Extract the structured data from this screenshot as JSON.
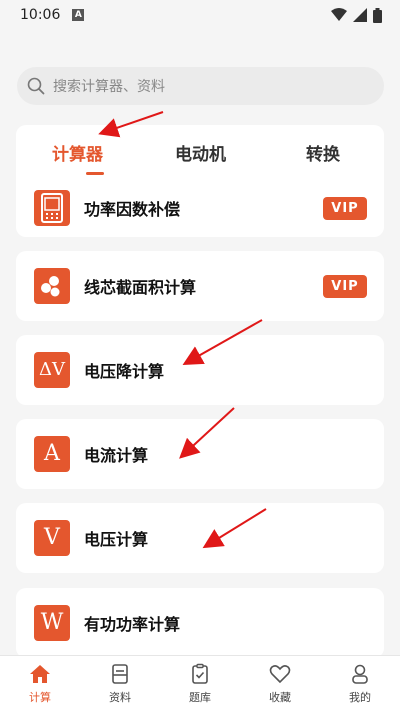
{
  "status": {
    "time": "10:06",
    "a_label": "A"
  },
  "search": {
    "placeholder": "搜索计算器、资料"
  },
  "tabs": [
    {
      "label": "计算器",
      "active": true
    },
    {
      "label": "电动机"
    },
    {
      "label": "转换"
    }
  ],
  "items": [
    {
      "label": "功率因数补偿",
      "vip": "VIP",
      "icon": "phone-grid-icon"
    },
    {
      "label": "线芯截面积计算",
      "vip": "VIP",
      "icon": "wire-cores-icon"
    },
    {
      "label": "电压降计算",
      "icon_text": "ΔV"
    },
    {
      "label": "电流计算",
      "icon_text": "A"
    },
    {
      "label": "电压计算",
      "icon_text": "V"
    },
    {
      "label": "有功功率计算",
      "icon_text": "W"
    }
  ],
  "nav": [
    {
      "label": "计算",
      "icon": "home-icon",
      "active": true
    },
    {
      "label": "资料",
      "icon": "document-icon"
    },
    {
      "label": "题库",
      "icon": "checklist-icon"
    },
    {
      "label": "收藏",
      "icon": "heart-icon"
    },
    {
      "label": "我的",
      "icon": "user-icon"
    }
  ],
  "colors": {
    "accent": "#e4572e",
    "background": "#f5f5f5"
  }
}
